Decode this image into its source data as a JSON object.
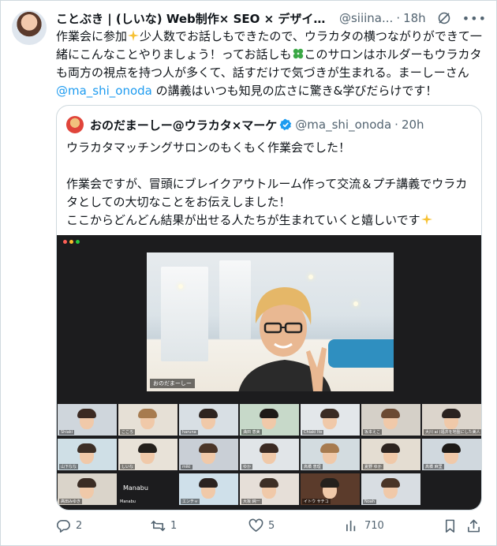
{
  "tweet": {
    "author_name": "ことぶき | (しいな) Web制作× SEO × デザインで集客...",
    "handle": "@siiina...",
    "separator": "·",
    "time": "18h",
    "text_part1": "作業会に参加",
    "text_part2": "少人数でお話しもできたので、ウラカタの横つながりができて一緒にこんなことやりましょう！ってお話しも",
    "text_part3": "このサロンはホルダーもウラカタも両方の視点を持つ人が多くて、話すだけで気づきが生まれる。まーしーさん",
    "mention": "@ma_shi_onoda",
    "text_part4": " の講義はいつも知見の広さに驚き&学びだらけです！"
  },
  "quote": {
    "author_name": "おのだまーしー@ウラカタ×マーケ",
    "handle": "@ma_shi_onoda",
    "separator": "·",
    "time": "20h",
    "text": "ウラカタマッチングサロンのもくもく作業会でした！\n\n作業会ですが、冒頭にブレイクアウトルーム作って交流＆プチ講義でウラカタとしての大切なことをお伝えしました！\nここからどんどん結果が出せる人たちが生まれていくと嬉しいです"
  },
  "video": {
    "main_label": "おのだまーしー",
    "participants": [
      {
        "label": "Shiaki"
      },
      {
        "label": "こころ"
      },
      {
        "label": "haruna"
      },
      {
        "label": "満田 恵美"
      },
      {
        "label": "Chiaki Ito"
      },
      {
        "label": "坂本えこ"
      },
      {
        "label": "大川 ai (福井を地盤にした美人"
      },
      {
        "label": "山下なな"
      },
      {
        "label": "しいな"
      },
      {
        "label": "miki"
      },
      {
        "label": "ゆか"
      },
      {
        "label": "高橋 恵理"
      },
      {
        "label": "夏野 ゆか"
      },
      {
        "label": "高橋 麻里"
      },
      {
        "label": "髙田みゆき"
      },
      {
        "label": "Manabu",
        "big": "Manabu"
      },
      {
        "label": "エンチャ"
      },
      {
        "label": "大坂 純一"
      },
      {
        "label": "イトウ サチコ"
      },
      {
        "label": "Noah"
      }
    ]
  },
  "actions": {
    "replies": "2",
    "reposts": "1",
    "likes": "5",
    "views": "710"
  },
  "colors": {
    "link": "#1d9bf0",
    "muted": "#536471",
    "verified": "#1d9bf0"
  }
}
